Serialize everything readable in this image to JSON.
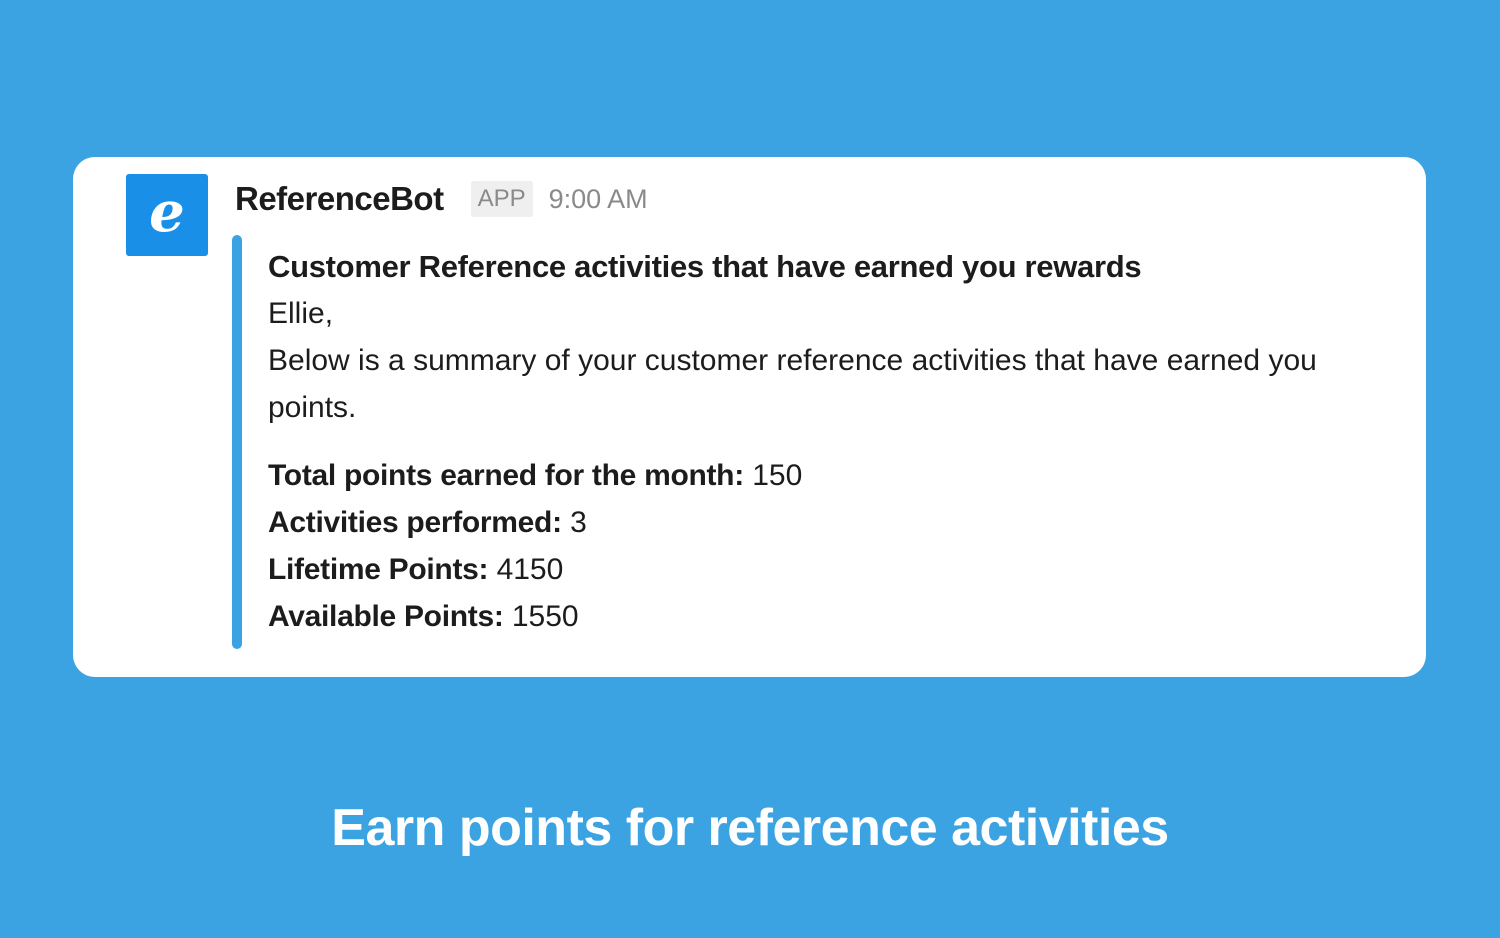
{
  "message": {
    "bot_name": "ReferenceBot",
    "badge": "APP",
    "time": "9:00 AM",
    "avatar_letter": "e",
    "avatar_color": "#1a8fe8",
    "title": "Customer Reference activities that have earned you rewards",
    "greeting": "Ellie,",
    "summary": "Below is a summary of your customer reference activities that have earned you points.",
    "stats": [
      {
        "label": "Total points earned for the month:",
        "value": "150"
      },
      {
        "label": "Activities performed:",
        "value": "3"
      },
      {
        "label": "Lifetime Points:",
        "value": "4150"
      },
      {
        "label": "Available Points:",
        "value": "1550"
      }
    ]
  },
  "caption": "Earn points for reference activities",
  "colors": {
    "background": "#3ba3e2",
    "card": "#ffffff",
    "accent_bar": "#3ba3e2"
  }
}
